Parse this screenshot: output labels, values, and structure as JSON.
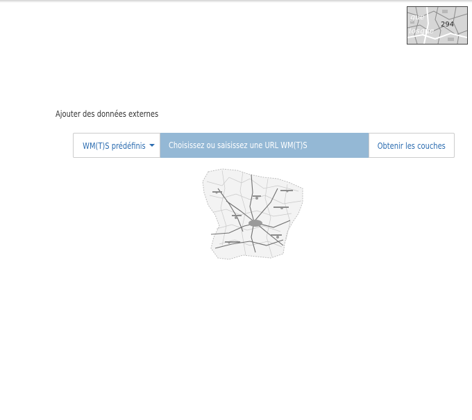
{
  "thumbnail": {
    "label": "294",
    "text_lines": [
      "gue",
      "iosque"
    ]
  },
  "section": {
    "title": "Ajouter des données externes"
  },
  "toolbar": {
    "predefined_label": "WM(T)S prédéfinis",
    "url_placeholder": "Choisissez ou saisissez une URL WM(T)S",
    "url_value": "",
    "get_layers_label": "Obtenir les couches"
  },
  "colors": {
    "accent": "#2b6cb0",
    "input_bg": "#94b8d5",
    "border": "#cccccc"
  },
  "icons": {
    "caret": "caret-down-icon"
  }
}
